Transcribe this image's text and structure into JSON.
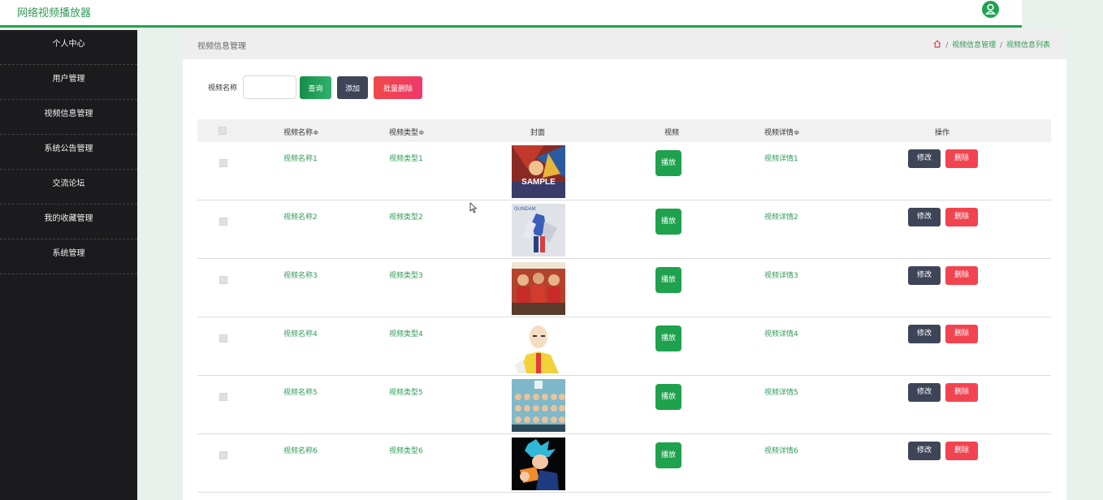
{
  "header": {
    "app_title": "网络视频播放器",
    "user_icon": "user-icon"
  },
  "sidebar": {
    "items": [
      {
        "label": "个人中心"
      },
      {
        "label": "用户管理"
      },
      {
        "label": "视频信息管理"
      },
      {
        "label": "系统公告管理"
      },
      {
        "label": "交流论坛"
      },
      {
        "label": "我的收藏管理"
      },
      {
        "label": "系统管理"
      }
    ]
  },
  "panel": {
    "title": "视频信息管理",
    "breadcrumb": {
      "home_icon": "home-icon",
      "sep": "/",
      "level1": "视频信息管理",
      "level2": "视频信息列表"
    }
  },
  "search": {
    "label": "视频名称",
    "value": "",
    "query_label": "查询",
    "add_label": "添加",
    "batch_delete_label": "批量删除"
  },
  "table": {
    "headers": {
      "name": "视频名称≑",
      "type": "视频类型≑",
      "cover": "封面",
      "video": "视频",
      "detail": "视频详情≑",
      "ops": "操作"
    },
    "rows": [
      {
        "name": "视频名称1",
        "type": "视频类型1",
        "play": "播放",
        "detail": "视频详情1",
        "edit": "修改",
        "delete": "删除",
        "cover_text": "SAMPLE"
      },
      {
        "name": "视频名称2",
        "type": "视频类型2",
        "play": "播放",
        "detail": "视频详情2",
        "edit": "修改",
        "delete": "删除",
        "cover_text": "GUNDAM"
      },
      {
        "name": "视频名称3",
        "type": "视频类型3",
        "play": "播放",
        "detail": "视频详情3",
        "edit": "修改",
        "delete": "删除"
      },
      {
        "name": "视频名称4",
        "type": "视频类型4",
        "play": "播放",
        "detail": "视频详情4",
        "edit": "修改",
        "delete": "删除"
      },
      {
        "name": "视频名称5",
        "type": "视频类型5",
        "play": "播放",
        "detail": "视频详情5",
        "edit": "修改",
        "delete": "删除"
      },
      {
        "name": "视频名称6",
        "type": "视频类型6",
        "play": "播放",
        "detail": "视频详情6",
        "edit": "修改",
        "delete": "删除"
      }
    ]
  },
  "colors": {
    "accent": "#20a34f",
    "sidebar_bg": "#1b1b1d",
    "danger": "#f24450",
    "dark_button": "#3f4558"
  }
}
